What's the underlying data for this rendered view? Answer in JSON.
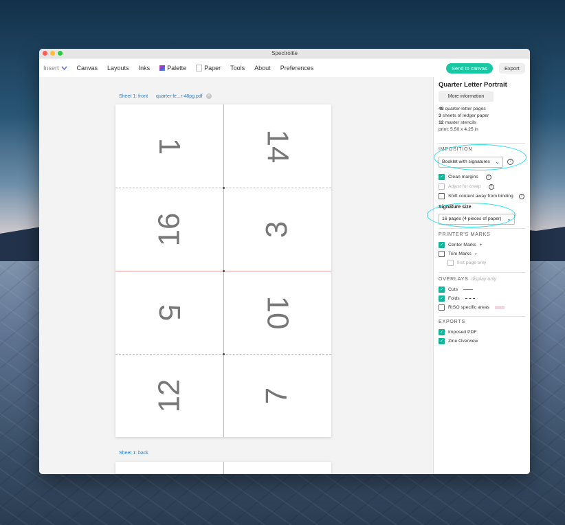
{
  "window": {
    "title": "Spectrolite"
  },
  "toolbar": {
    "insert": "Insert",
    "menu": [
      "Canvas",
      "Layouts",
      "Inks",
      "Palette",
      "Paper",
      "Tools",
      "About",
      "Preferences"
    ],
    "send": "Send to canvas",
    "export": "Export"
  },
  "canvas": {
    "front_label": "Sheet 1: front",
    "file_name": "quarter-le...r-48pg.pdf",
    "back_label": "Sheet 1: back",
    "pages": [
      "1",
      "14",
      "16",
      "3",
      "5",
      "10",
      "12",
      "7"
    ]
  },
  "panel": {
    "title": "Quarter Letter Portrait",
    "more_info": "More information",
    "stats": {
      "pages_num": "48",
      "pages_text": " quarter-letter pages",
      "sheets_num": "3",
      "sheets_text": " sheets of ledger paper",
      "stencils_num": "12",
      "stencils_text": " master stencils",
      "print": "print: 5.50 x 4.25 in"
    },
    "imposition": {
      "heading": "IMPOSITION",
      "selected": "Booklet with signatures",
      "clean_margins": "Clean margins",
      "adjust_creep": "Adjust for creep",
      "shift_content": "Shift content away from binding",
      "signature_label": "Signature size",
      "signature_selected": "16 pages (4 pieces of paper)"
    },
    "printers_marks": {
      "heading": "PRINTER'S MARKS",
      "center": "Center Marks",
      "trim": "Trim Marks",
      "first_page": "first page only"
    },
    "overlays": {
      "heading": "OVERLAYS",
      "sub": "display only",
      "cuts": "Cuts",
      "folds": "Folds",
      "riso": "RISO specific areas"
    },
    "exports": {
      "heading": "EXPORTS",
      "pdf": "Imposed PDF",
      "zine": "Zine Overview"
    }
  },
  "colors": {
    "accent": "#17c8a3",
    "highlight": "#17e2f0",
    "cut": "#d2487a",
    "link": "#2d7cc1"
  }
}
